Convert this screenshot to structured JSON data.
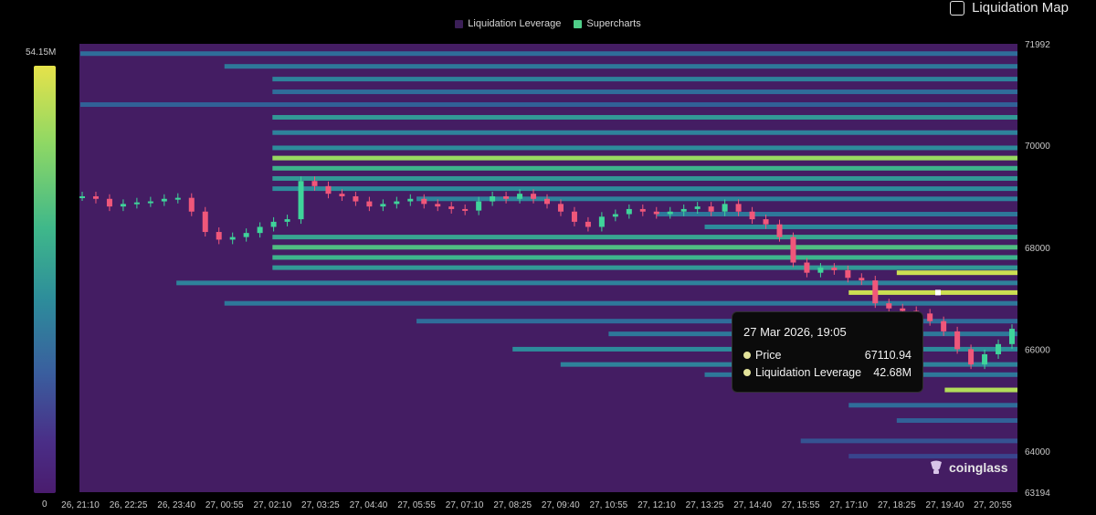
{
  "header": {
    "legend": [
      {
        "label": "Liquidation Leverage",
        "color": "#3b1f57"
      },
      {
        "label": "Supercharts",
        "color": "#4fce88"
      }
    ],
    "toggle_label": "Liquidation Map",
    "toggle_checked": false
  },
  "colorscale": {
    "max_label": "54.15M",
    "min_label": "0",
    "colors": [
      "#e6e24a",
      "#8fd864",
      "#3fb88a",
      "#2d8c9b",
      "#3a5e9e",
      "#4a2e87",
      "#4a1c6e"
    ]
  },
  "tooltip": {
    "title": "27 Mar 2026, 19:05",
    "rows": [
      {
        "label": "Price",
        "value": "67110.94"
      },
      {
        "label": "Liquidation Leverage",
        "value": "42.68M"
      }
    ]
  },
  "watermark": {
    "text": "coinglass",
    "icon": "coinglass-logo-icon"
  },
  "chart_data": {
    "type": "heatmap",
    "title": "",
    "xlabel": "",
    "ylabel": "",
    "x_ticks": [
      "26, 21:10",
      "26, 22:25",
      "26, 23:40",
      "27, 00:55",
      "27, 02:10",
      "27, 03:25",
      "27, 04:40",
      "27, 05:55",
      "27, 07:10",
      "27, 08:25",
      "27, 09:40",
      "27, 10:55",
      "27, 12:10",
      "27, 13:25",
      "27, 14:40",
      "27, 15:55",
      "27, 17:10",
      "27, 18:25",
      "27, 19:40",
      "27, 20:55"
    ],
    "y_ticks": [
      71992,
      70000,
      68000,
      66000,
      64000,
      63194
    ],
    "ylim": [
      63194,
      71992
    ],
    "colorscale_range": [
      0,
      54150000
    ],
    "selected_point": {
      "time": "27 Mar 2026, 19:05",
      "price": 67110.94,
      "liquidation_leverage": 42680000
    },
    "price_series": {
      "name": "Supercharts",
      "type": "candlestick",
      "close": [
        69000,
        68950,
        68800,
        68850,
        68880,
        68900,
        68950,
        68970,
        68700,
        68300,
        68150,
        68200,
        68280,
        68400,
        68500,
        68550,
        69300,
        69200,
        69050,
        69000,
        68900,
        68800,
        68850,
        68900,
        68950,
        68850,
        68800,
        68750,
        68720,
        68900,
        69000,
        68950,
        69050,
        68950,
        68850,
        68700,
        68500,
        68400,
        68600,
        68650,
        68750,
        68700,
        68650,
        68700,
        68750,
        68800,
        68700,
        68850,
        68700,
        68550,
        68450,
        68200,
        67700,
        67500,
        67600,
        67550,
        67400,
        67350,
        66900,
        66800,
        66750,
        66700,
        66550,
        66350,
        66000,
        65700,
        65900,
        66100,
        66400
      ],
      "open": [
        69000,
        69000,
        68950,
        68800,
        68850,
        68880,
        68900,
        68950,
        68970,
        68700,
        68300,
        68150,
        68200,
        68280,
        68400,
        68500,
        68550,
        69300,
        69200,
        69050,
        69000,
        68900,
        68800,
        68850,
        68900,
        68950,
        68850,
        68800,
        68750,
        68720,
        68900,
        69000,
        68950,
        69050,
        68950,
        68850,
        68700,
        68500,
        68400,
        68600,
        68650,
        68750,
        68700,
        68650,
        68700,
        68750,
        68800,
        68700,
        68850,
        68700,
        68550,
        68450,
        68200,
        67700,
        67500,
        67600,
        67550,
        67400,
        67350,
        66900,
        66800,
        66750,
        66700,
        66550,
        66350,
        66000,
        65700,
        65900,
        66100
      ]
    },
    "liquidation_bands": [
      {
        "price": 71800,
        "level": 0.35,
        "start": "26, 21:10"
      },
      {
        "price": 71550,
        "level": 0.4,
        "start": "27, 00:55"
      },
      {
        "price": 71300,
        "level": 0.45,
        "start": "27, 02:10"
      },
      {
        "price": 71050,
        "level": 0.35,
        "start": "27, 02:10"
      },
      {
        "price": 70800,
        "level": 0.3,
        "start": "26, 21:10"
      },
      {
        "price": 70550,
        "level": 0.55,
        "start": "27, 02:10"
      },
      {
        "price": 70250,
        "level": 0.45,
        "start": "27, 02:10"
      },
      {
        "price": 69950,
        "level": 0.5,
        "start": "27, 02:10"
      },
      {
        "price": 69750,
        "level": 0.85,
        "start": "27, 02:10"
      },
      {
        "price": 69550,
        "level": 0.65,
        "start": "27, 02:10"
      },
      {
        "price": 69350,
        "level": 0.55,
        "start": "27, 02:10"
      },
      {
        "price": 69150,
        "level": 0.5,
        "start": "27, 02:10"
      },
      {
        "price": 68950,
        "level": 0.45,
        "start": "27, 05:55"
      },
      {
        "price": 68650,
        "level": 0.4,
        "start": "27, 12:10"
      },
      {
        "price": 68400,
        "level": 0.5,
        "start": "27, 13:25"
      },
      {
        "price": 68200,
        "level": 0.6,
        "start": "27, 02:10"
      },
      {
        "price": 68000,
        "level": 0.7,
        "start": "27, 02:10"
      },
      {
        "price": 67800,
        "level": 0.65,
        "start": "27, 02:10"
      },
      {
        "price": 67600,
        "level": 0.55,
        "start": "27, 02:10"
      },
      {
        "price": 67500,
        "level": 0.95,
        "start": "27, 18:25"
      },
      {
        "price": 67300,
        "level": 0.45,
        "start": "26, 23:40"
      },
      {
        "price": 67110.94,
        "level": 0.95,
        "start": "27, 17:10"
      },
      {
        "price": 66900,
        "level": 0.4,
        "start": "27, 00:55"
      },
      {
        "price": 66550,
        "level": 0.35,
        "start": "27, 05:55"
      },
      {
        "price": 66300,
        "level": 0.4,
        "start": "27, 10:55"
      },
      {
        "price": 66000,
        "level": 0.5,
        "start": "27, 08:25"
      },
      {
        "price": 65700,
        "level": 0.45,
        "start": "27, 09:40"
      },
      {
        "price": 65500,
        "level": 0.4,
        "start": "27, 13:25"
      },
      {
        "price": 65200,
        "level": 0.9,
        "start": "27, 19:40"
      },
      {
        "price": 64900,
        "level": 0.35,
        "start": "27, 17:10"
      },
      {
        "price": 64600,
        "level": 0.3,
        "start": "27, 18:25"
      },
      {
        "price": 64200,
        "level": 0.25,
        "start": "27, 15:55"
      },
      {
        "price": 63900,
        "level": 0.2,
        "start": "27, 17:10"
      }
    ]
  }
}
